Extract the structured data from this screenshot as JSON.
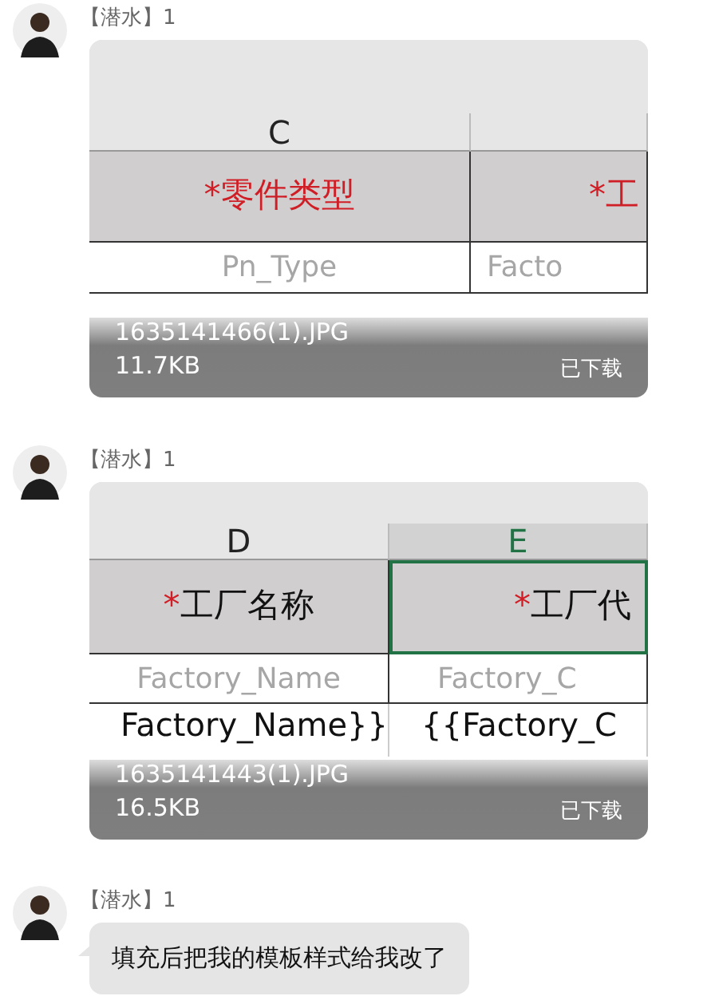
{
  "messages": [
    {
      "kind": "image",
      "sender": "【潜水】1",
      "file_name": "1635141466(1).JPG",
      "file_size": "11.7KB",
      "status": "已下载",
      "sheet": {
        "columns": [
          {
            "letter": "C",
            "selected": false
          },
          {
            "selected": false
          }
        ],
        "rows": [
          [
            {
              "kind": "header",
              "parts": [
                {
                  "text": "*",
                  "color": "#d01e26"
                },
                {
                  "text": "零件类型",
                  "color": "#d01e26"
                }
              ]
            },
            {
              "kind": "header",
              "parts": [
                {
                  "text": "*",
                  "color": "#d01e26"
                },
                {
                  "text": "工",
                  "color": "#d01e26"
                }
              ]
            }
          ],
          [
            {
              "kind": "field",
              "text": "Pn_Type"
            },
            {
              "kind": "field",
              "text": "Facto"
            }
          ]
        ]
      }
    },
    {
      "kind": "image",
      "sender": "【潜水】1",
      "file_name": "1635141443(1).JPG",
      "file_size": "16.5KB",
      "status": "已下载",
      "sheet": {
        "columns": [
          {
            "letter": "D",
            "selected": false
          },
          {
            "letter": "E",
            "selected": true
          }
        ],
        "rows": [
          [
            {
              "kind": "header",
              "parts": [
                {
                  "text": "*",
                  "color": "#d01e26"
                },
                {
                  "text": "工厂名称",
                  "color": "#111111"
                }
              ]
            },
            {
              "kind": "header",
              "parts": [
                {
                  "text": "*",
                  "color": "#d01e26"
                },
                {
                  "text": "工厂代",
                  "color": "#111111"
                }
              ]
            }
          ],
          [
            {
              "kind": "field",
              "text": "Factory_Name"
            },
            {
              "kind": "field",
              "text": "Factory_C"
            }
          ],
          [
            {
              "kind": "value",
              "text": "Factory_Name}}"
            },
            {
              "kind": "value",
              "text": "{{Factory_C"
            }
          ]
        ]
      }
    },
    {
      "kind": "text",
      "sender": "【潜水】1",
      "text": "填充后把我的模板样式给我改了"
    }
  ]
}
